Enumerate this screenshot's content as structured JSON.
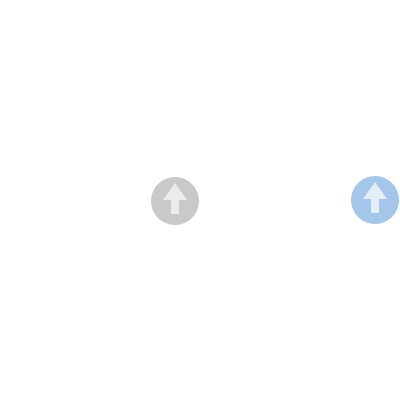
{
  "buttons": [
    {
      "id": "upvote-default",
      "icon": "arrow-up-icon",
      "state": "default",
      "bg_color": "#c9c9c9",
      "icon_color": "#ececec"
    },
    {
      "id": "upvote-active",
      "icon": "arrow-up-icon",
      "state": "active",
      "bg_color": "#a4c6eb",
      "icon_color": "#e3eef8"
    }
  ]
}
